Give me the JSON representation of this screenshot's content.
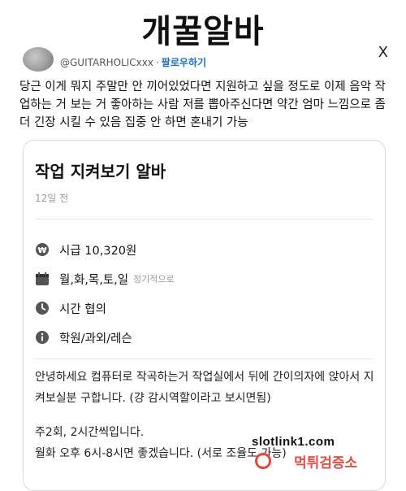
{
  "headline": "개꿀알바",
  "tweet": {
    "handle": "@GUITARHOLICxxx",
    "separator": "·",
    "follow_label": "팔로우하기",
    "close_glyph": "X",
    "text": "당근 이게 뭐지 주말만 안 끼어있었다면 지원하고 싶을 정도로 이제 음악 작업하는 거 보는 거 좋아하는 사람 저를 뽑아주신다면 약간 엄마 느낌으로 좀 더 긴장 시킬 수 있음 집중 안 하면 혼내기 가능"
  },
  "card": {
    "title": "작업 지켜보기 알바",
    "date": "12일 전",
    "details": [
      {
        "icon": "wage-coin-icon",
        "text": "시급 10,320원",
        "sub": ""
      },
      {
        "icon": "calendar-icon",
        "text": "월,화,목,토,일",
        "sub": "정기적으로"
      },
      {
        "icon": "clock-icon",
        "text": "시간 협의",
        "sub": ""
      },
      {
        "icon": "info-icon",
        "text": "학원/과외/레슨",
        "sub": ""
      }
    ],
    "description_1": "안녕하세요 컴퓨터로 작곡하는거 작업실에서 뒤에 간이의자에 앉아서 지켜보실분 구합니다. (걍 감시역할이라고 보시면됨)",
    "description_2": "주2회, 2시간씩입니다.",
    "description_3": "월화 오후 6시-8시면 좋겠습니다. (서로 조율도 가능)"
  },
  "watermark": {
    "main": "slotlink1.com",
    "sub": "먹튀검증소"
  },
  "colors": {
    "follow_link": "#1d6fb8",
    "muted_text": "#999999",
    "watermark_red": "#d8322a"
  }
}
